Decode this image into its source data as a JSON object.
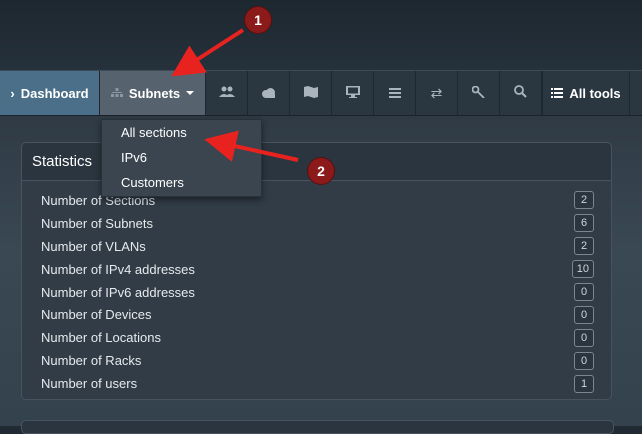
{
  "nav": {
    "dashboard": "Dashboard",
    "subnets": "Subnets",
    "all_tools": "All tools",
    "icons": [
      "users-icon",
      "cloud-icon",
      "map-icon",
      "desktop-icon",
      "list-icon",
      "shuffle-icon",
      "key-icon",
      "search-icon"
    ]
  },
  "dropdown": {
    "items": [
      "All sections",
      "IPv6",
      "Customers"
    ]
  },
  "statistics": {
    "title": "Statistics",
    "rows": [
      {
        "label": "Number of Sections",
        "value": "2"
      },
      {
        "label": "Number of Subnets",
        "value": "6"
      },
      {
        "label": "Number of VLANs",
        "value": "2"
      },
      {
        "label": "Number of IPv4 addresses",
        "value": "10"
      },
      {
        "label": "Number of IPv6 addresses",
        "value": "0"
      },
      {
        "label": "Number of Devices",
        "value": "0"
      },
      {
        "label": "Number of Locations",
        "value": "0"
      },
      {
        "label": "Number of Racks",
        "value": "0"
      },
      {
        "label": "Number of users",
        "value": "1"
      }
    ]
  },
  "annotations": {
    "marker_1": "1",
    "marker_2": "2",
    "arrow_color": "#e8231f"
  },
  "colors": {
    "dashboard_active": "#4b6f88",
    "subnets_active": "#56636e"
  }
}
